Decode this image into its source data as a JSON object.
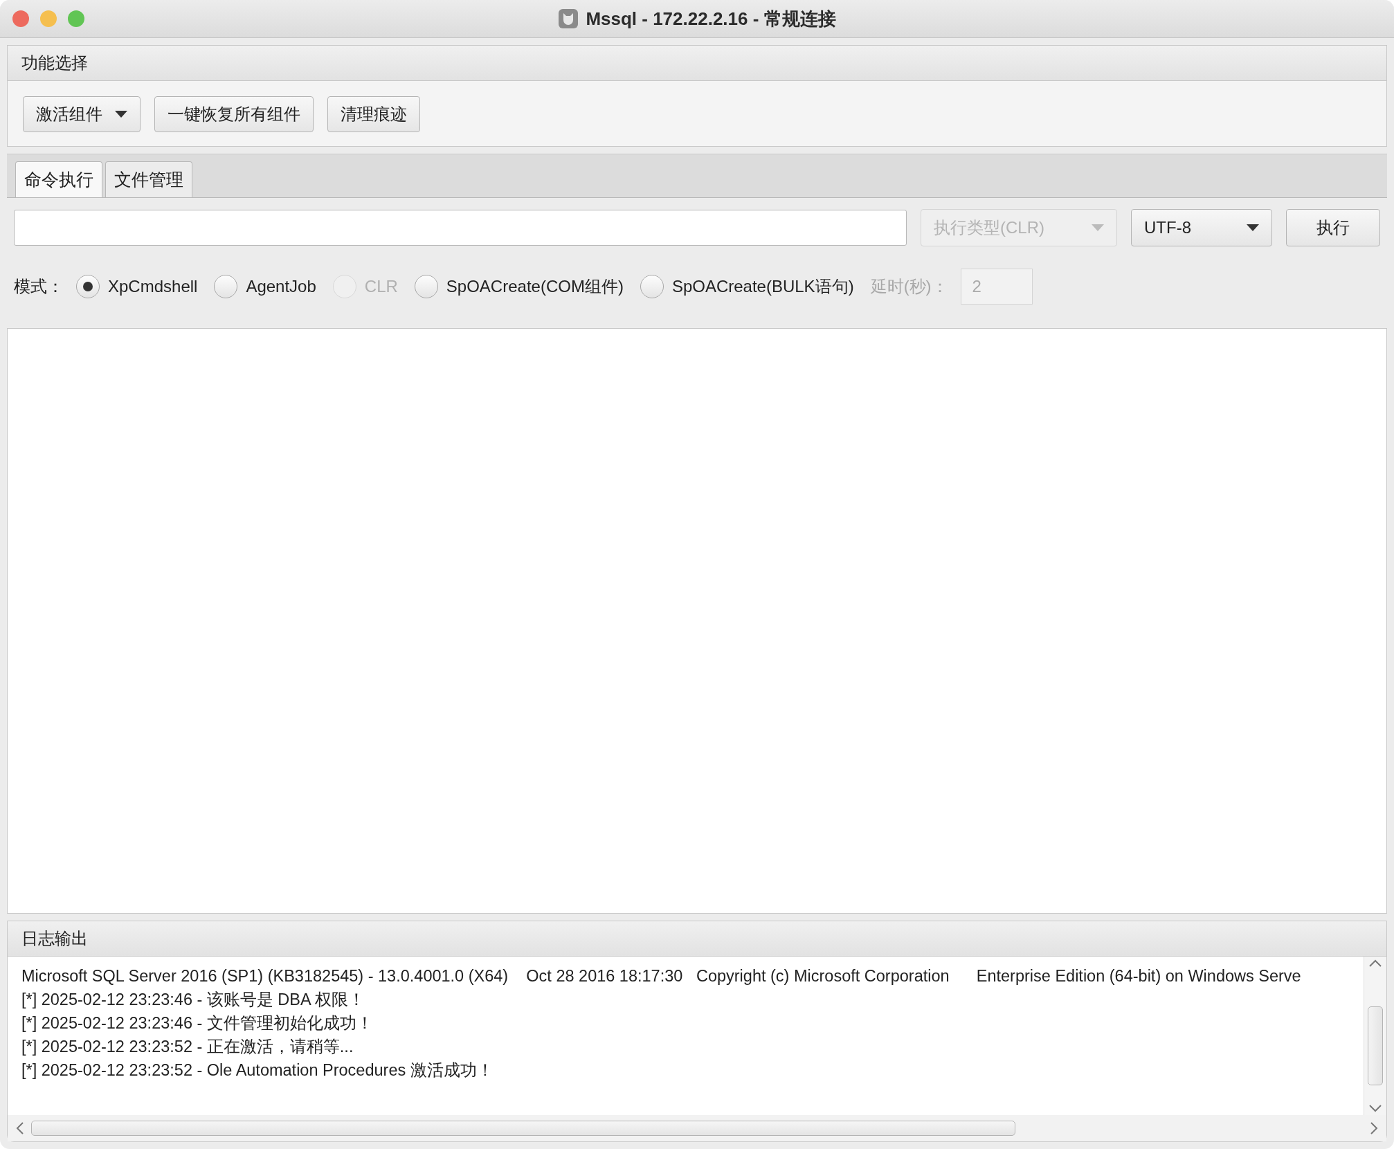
{
  "window": {
    "title": "Mssql - 172.22.2.16 - 常规连接"
  },
  "function_panel": {
    "title": "功能选择",
    "buttons": [
      {
        "label": "激活组件",
        "kind": "dropdown"
      },
      {
        "label": "一键恢复所有组件",
        "kind": "plain"
      },
      {
        "label": "清理痕迹",
        "kind": "plain"
      }
    ]
  },
  "tabs": [
    {
      "label": "命令执行",
      "selected": true
    },
    {
      "label": "文件管理",
      "selected": false
    }
  ],
  "command": {
    "exec_type": {
      "label": "执行类型(CLR)",
      "disabled": true
    },
    "encoding": {
      "label": "UTF-8",
      "disabled": false
    },
    "run_button": "执行"
  },
  "mode": {
    "label": "模式：",
    "options": [
      {
        "label": "XpCmdshell",
        "selected": true,
        "disabled": false
      },
      {
        "label": "AgentJob",
        "selected": false,
        "disabled": false
      },
      {
        "label": "CLR",
        "selected": false,
        "disabled": true
      },
      {
        "label": "SpOACreate(COM组件)",
        "selected": false,
        "disabled": false
      },
      {
        "label": "SpOACreate(BULK语句)",
        "selected": false,
        "disabled": false
      }
    ],
    "delay_label": "延时(秒)：",
    "delay_value": "2",
    "delay_disabled": true
  },
  "log_panel": {
    "title": "日志输出",
    "lines": [
      "Microsoft SQL Server 2016 (SP1) (KB3182545) - 13.0.4001.0 (X64)    Oct 28 2016 18:17:30   Copyright (c) Microsoft Corporation      Enterprise Edition (64-bit) on Windows Serve",
      "[*] 2025-02-12 23:23:46 - 该账号是 DBA 权限！",
      "[*] 2025-02-12 23:23:46 - 文件管理初始化成功！",
      "[*] 2025-02-12 23:23:52 - 正在激活，请稍等...",
      "[*] 2025-02-12 23:23:52 - Ole Automation Procedures 激活成功！"
    ]
  }
}
